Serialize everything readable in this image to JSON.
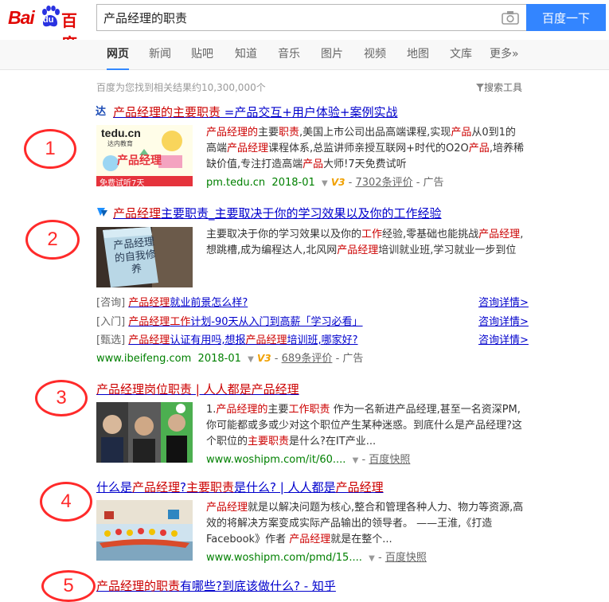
{
  "header": {
    "logo_bai": "Bai",
    "logo_du": "du",
    "logo_cn": "百度",
    "search_value": "产品经理的职责",
    "search_button": "百度一下"
  },
  "nav": {
    "items": [
      "网页",
      "新闻",
      "贴吧",
      "知道",
      "音乐",
      "图片",
      "视频",
      "地图",
      "文库",
      "更多»"
    ]
  },
  "stats": {
    "text": "百度为您找到相关结果约10,300,000个",
    "tools": "搜索工具"
  },
  "results": {
    "r1": {
      "title_a": "产品经理的主要职责",
      "title_b": " =产品交互+用户体验+案例实战",
      "desc_a": "产品经理的",
      "desc_b": "主要",
      "desc_c": "职责",
      "desc_d": ",美国上市公司出品高端课程,实现",
      "desc_e": "产品",
      "desc_f": "从0到1的高端",
      "desc_g": "产品经理",
      "desc_h": "课程体系,总监讲师亲授互联网+时代的O2O",
      "desc_i": "产品",
      "desc_j": ",培养稀缺价值,专注打造高端",
      "desc_k": "产品",
      "desc_l": "大师!7天免费试听",
      "url": "pm.tedu.cn",
      "date": "2018-01",
      "v3": "V3",
      "reviews": "7302条评价",
      "ad": "- 广告",
      "thumb_brand": "tedu.cn",
      "thumb_brand_sub": "达内教育",
      "thumb_text": "产品经理",
      "thumb_banner": "免费试听7天"
    },
    "r2": {
      "title_a": "产品经理",
      "title_b": "主要职责",
      "title_c": "_主要取决于你的学习效果以及你的工作经验",
      "desc_a": "主要取决于你的学习效果以及你的",
      "desc_b": "工作",
      "desc_c": "经验,零基础也能挑战",
      "desc_d": "产品经理",
      "desc_e": ",想跳槽,成为编程达人,北风网",
      "desc_f": "产品经理",
      "desc_g": "培训就业班,学习就业一步到位",
      "book_title": "产品经理的自我修养",
      "subs": [
        {
          "tag": "[咨询]",
          "em": "产品经理",
          "text": "就业前景怎么样?",
          "detail": "咨询详情>"
        },
        {
          "tag": "[入门]",
          "em": "产品经理",
          "em2": "工作",
          "text": "计划-90天从入门到高薪「学习必看」",
          "detail": "咨询详情>"
        },
        {
          "tag": "[甄选]",
          "em": "产品经理",
          "text": "认证有用吗,想报",
          "em3": "产品经理",
          "text2": "培训班,哪家好?",
          "detail": "咨询详情>"
        }
      ],
      "url": "www.ibeifeng.com",
      "date": "2018-01",
      "v3": "V3",
      "reviews": "689条评价",
      "ad": "- 广告"
    },
    "r3": {
      "title": "产品经理岗位职责 | 人人都是产品经理",
      "desc_a": "1.",
      "desc_b": "产品经理的",
      "desc_c": "主要",
      "desc_d": "工作职责",
      "desc_e": " 作为一名新进产品经理,甚至一名资深PM,你可能都或多或少对这个职位产生某种迷惑。到底什么是产品经理?这个职位的",
      "desc_f": "主要职责",
      "desc_g": "是什么?在IT产业...",
      "url": "www.woshipm.com/it/60....",
      "snapshot": "百度快照"
    },
    "r4": {
      "title_a": "什么是",
      "title_b": "产品经理",
      "title_c": "?",
      "title_d": "主要职责",
      "title_e": "是什么? | 人人都是",
      "title_f": "产品经理",
      "desc_a": "产品经理",
      "desc_b": "就是以解决问题为核心,整合和管理各种人力、物力等资源,高效的将解决方案变成实际产品输出的领导者。 ——王淮,《打造Facebook》作者 ",
      "desc_c": "产品经理",
      "desc_d": "就是在整个...",
      "url": "www.woshipm.com/pmd/15....",
      "snapshot": "百度快照"
    },
    "r5": {
      "title_a": "产品经理的职责",
      "title_b": "有哪些?到底该做什么? - 知乎"
    }
  },
  "annotations": [
    "1",
    "2",
    "3",
    "4",
    "5"
  ],
  "colors": {
    "link": "#0000cc",
    "highlight": "#cc0000",
    "url": "#008000",
    "button": "#3385ff",
    "annotation": "#ff2a2a",
    "logo": "#e10602"
  }
}
